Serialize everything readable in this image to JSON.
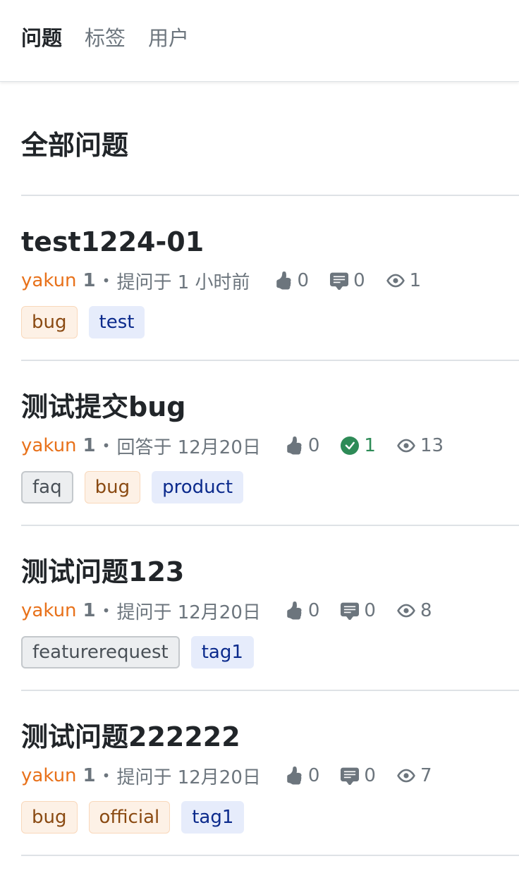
{
  "nav": {
    "items": [
      {
        "label": "问题",
        "active": true
      },
      {
        "label": "标签",
        "active": false
      },
      {
        "label": "用户",
        "active": false
      }
    ]
  },
  "page": {
    "title": "全部问题"
  },
  "questions": [
    {
      "title": "test1224-01",
      "author": "yakun",
      "rep": "1",
      "action": "提问于 1 小时前",
      "votes": "0",
      "answers": "0",
      "answered": false,
      "views": "1",
      "tags": [
        {
          "label": "bug",
          "style": "orange"
        },
        {
          "label": "test",
          "style": "blue"
        }
      ]
    },
    {
      "title": "测试提交bug",
      "author": "yakun",
      "rep": "1",
      "action": "回答于 12月20日",
      "votes": "0",
      "answers": "1",
      "answered": true,
      "views": "13",
      "tags": [
        {
          "label": "faq",
          "style": "gray"
        },
        {
          "label": "bug",
          "style": "orange"
        },
        {
          "label": "product",
          "style": "blue"
        }
      ]
    },
    {
      "title": "测试问题123",
      "author": "yakun",
      "rep": "1",
      "action": "提问于 12月20日",
      "votes": "0",
      "answers": "0",
      "answered": false,
      "views": "8",
      "tags": [
        {
          "label": "featurerequest",
          "style": "gray"
        },
        {
          "label": "tag1",
          "style": "blue"
        }
      ]
    },
    {
      "title": "测试问题222222",
      "author": "yakun",
      "rep": "1",
      "action": "提问于 12月20日",
      "votes": "0",
      "answers": "0",
      "answered": false,
      "views": "7",
      "tags": [
        {
          "label": "bug",
          "style": "orange"
        },
        {
          "label": "official",
          "style": "orange"
        },
        {
          "label": "tag1",
          "style": "blue"
        }
      ]
    }
  ],
  "colors": {
    "accent_author": "#e8711a",
    "answered_green": "#2e8b57",
    "muted": "#6c757d"
  }
}
